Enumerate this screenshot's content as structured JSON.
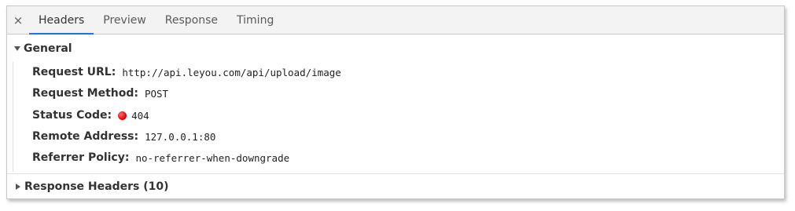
{
  "tabs": {
    "close_symbol": "×",
    "items": [
      {
        "label": "Headers",
        "active": true
      },
      {
        "label": "Preview",
        "active": false
      },
      {
        "label": "Response",
        "active": false
      },
      {
        "label": "Timing",
        "active": false
      }
    ]
  },
  "general": {
    "title": "General",
    "expanded": true,
    "rows": [
      {
        "key": "Request URL:",
        "value": "http://api.leyou.com/api/upload/image"
      },
      {
        "key": "Request Method:",
        "value": "POST"
      },
      {
        "key": "Status Code:",
        "value": "404",
        "status_color": "#d40000"
      },
      {
        "key": "Remote Address:",
        "value": "127.0.0.1:80"
      },
      {
        "key": "Referrer Policy:",
        "value": "no-referrer-when-downgrade"
      }
    ]
  },
  "response_headers": {
    "title": "Response Headers (10)",
    "expanded": false
  },
  "colors": {
    "active_tab_underline": "#1a73e8",
    "status_error": "#d40000"
  }
}
